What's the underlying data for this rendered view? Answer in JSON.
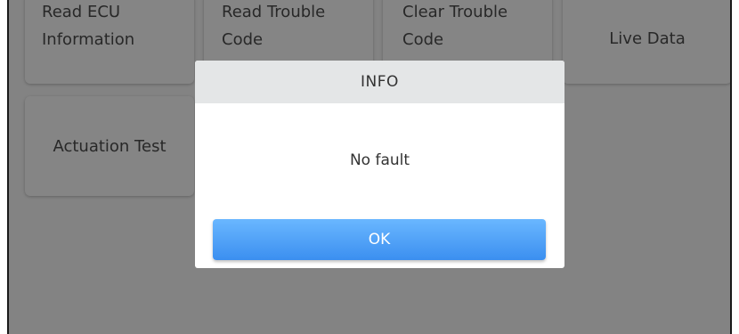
{
  "menu": {
    "tiles": [
      {
        "label": "Read ECU\nInformation"
      },
      {
        "label": "Read Trouble\nCode"
      },
      {
        "label": "Clear Trouble\nCode"
      },
      {
        "label": "Live Data"
      },
      {
        "label": "Actuation Test"
      }
    ]
  },
  "dialog": {
    "title": "INFO",
    "message": "No fault",
    "ok_label": "OK"
  }
}
